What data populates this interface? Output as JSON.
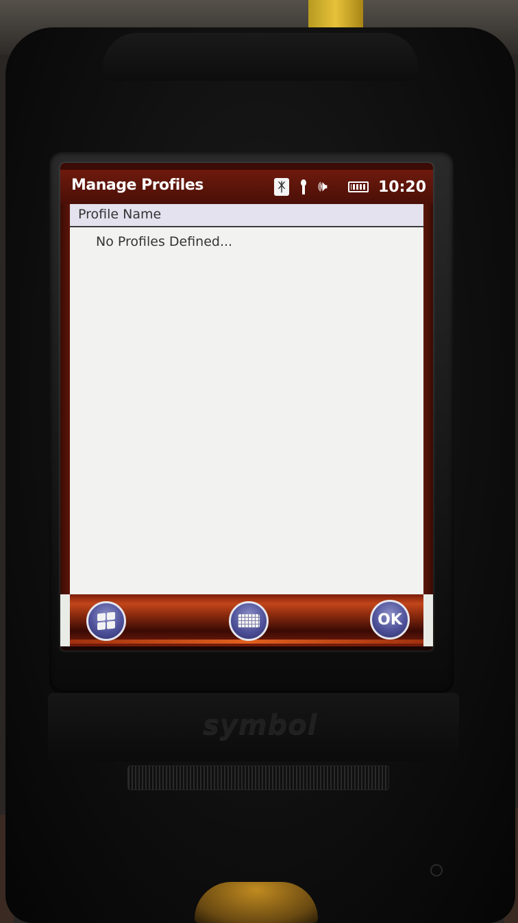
{
  "titlebar": {
    "title": "Manage Profiles",
    "clock": "10:20",
    "icons": [
      "bluetooth-icon",
      "signal-icon",
      "volume-icon",
      "battery-icon"
    ]
  },
  "list": {
    "column_header": "Profile Name",
    "empty_message": "No Profiles Defined..."
  },
  "softkeys": {
    "start_icon": "windows-start-icon",
    "keyboard_icon": "keyboard-icon",
    "ok_label": "OK"
  },
  "device": {
    "brand": "symbol"
  },
  "colors": {
    "titlebar": "#5a140a",
    "softbar_accent": "#c2461a",
    "orb": "#4f529a"
  }
}
